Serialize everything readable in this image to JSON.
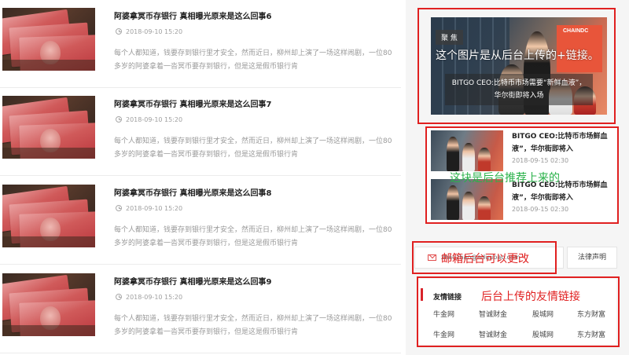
{
  "articles": [
    {
      "title": "阿婆拿冥币存银行 真相曝光原来是这么回事6",
      "date": "2018-09-10 15:20",
      "excerpt_line1": "每个人都知道，钱要存到银行里才安全，然而近日，柳州却上演了一场这样闹剧，一位80",
      "excerpt_line2": "多岁的阿婆拿着一沓冥币要存到银行，但是这是假币银行肯"
    },
    {
      "title": "阿婆拿冥币存银行 真相曝光原来是这么回事7",
      "date": "2018-09-10 15:20",
      "excerpt_line1": "每个人都知道，钱要存到银行里才安全，然而近日，柳州却上演了一场这样闹剧，一位80",
      "excerpt_line2": "多岁的阿婆拿着一沓冥币要存到银行，但是这是假币银行肯"
    },
    {
      "title": "阿婆拿冥币存银行 真相曝光原来是这么回事8",
      "date": "2018-09-10 15:20",
      "excerpt_line1": "每个人都知道，钱要存到银行里才安全，然而近日，柳州却上演了一场这样闹剧，一位80",
      "excerpt_line2": "多岁的阿婆拿着一沓冥币要存到银行，但是这是假币银行肯"
    },
    {
      "title": "阿婆拿冥币存银行 真相曝光原来是这么回事9",
      "date": "2018-09-10 15:20",
      "excerpt_line1": "每个人都知道，钱要存到银行里才安全，然而近日，柳州却上演了一场这样闹剧，一位80",
      "excerpt_line2": "多岁的阿婆拿着一沓冥币要存到银行，但是这是假币银行肯"
    }
  ],
  "focus": {
    "tag": "聚 焦",
    "caption": "BITGO CEO:比特币市场需要“新鲜血液”，华尔街即将入场",
    "sign_text": "CHAINDC",
    "annotation": "这个图片是从后台上传的+链接。"
  },
  "recommend": {
    "items": [
      {
        "title": "BITGO CEO:比特币市场鲜血液”，华尔街即将入",
        "date": "2018-09-15 02:30"
      },
      {
        "title": "BITGO CEO:比特币市场鲜血液”，华尔街即将入",
        "date": "2018-09-15 02:30"
      }
    ],
    "annotation": "这块是后台推荐上来的"
  },
  "contact": {
    "email": "zhaozhao@aduubao.com",
    "legal_label": "法律声明",
    "annotation": "邮箱后台可以更改"
  },
  "links": {
    "heading": "友情链接",
    "annotation": "后台上传的友情链接",
    "rows": [
      [
        "牛金网",
        "智诚财金",
        "股城网",
        "东方财富"
      ],
      [
        "牛金网",
        "智诚财金",
        "股城网",
        "东方财富"
      ]
    ]
  },
  "colors": {
    "annotation_red": "#e02020",
    "annotation_green": "#2ab24a",
    "accent_red": "#d8232a"
  }
}
